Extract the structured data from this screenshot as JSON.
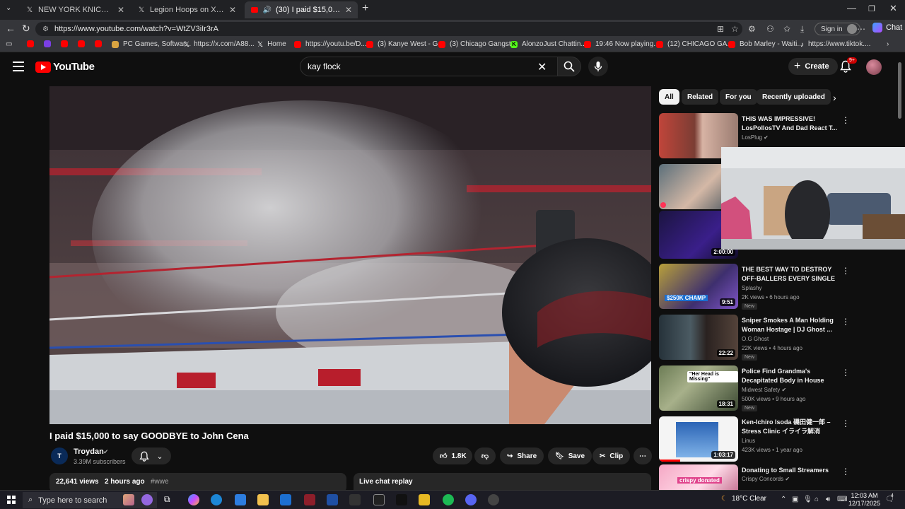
{
  "browser": {
    "tabs": [
      {
        "title": "NEW YORK KNICKS on X: \"THE CU",
        "icon": "x-logo-icon",
        "active": false
      },
      {
        "title": "Legion Hoops on X: \"The league a",
        "icon": "x-logo-icon",
        "active": false
      },
      {
        "title": "(30) I paid $15,000 to say GOO",
        "icon": "youtube-icon",
        "active": true
      }
    ],
    "url": "https://www.youtube.com/watch?v=WtZV3iIr3rA",
    "signin_label": "Sign in",
    "chat_label": "Chat",
    "bookmarks": [
      {
        "label": "",
        "icon": "youtube-icon"
      },
      {
        "label": "",
        "icon": "purple-app-icon"
      },
      {
        "label": "",
        "icon": "youtube-icon"
      },
      {
        "label": "",
        "icon": "youtube-icon"
      },
      {
        "label": "",
        "icon": "youtube-icon"
      },
      {
        "label": "PC Games, Softwar...",
        "icon": "site-icon"
      },
      {
        "label": "https://x.com/A88...",
        "icon": "x-logo-icon"
      },
      {
        "label": "Home",
        "icon": "x-logo-icon"
      },
      {
        "label": "https://youtu.be/D...",
        "icon": "youtube-icon"
      },
      {
        "label": "(3) Kanye West - G...",
        "icon": "youtube-icon"
      },
      {
        "label": "(3) Chicago Gangst...",
        "icon": "youtube-icon"
      },
      {
        "label": "AlonzoJust Chattin...",
        "icon": "kick-icon"
      },
      {
        "label": "19:46 Now playing...",
        "icon": "youtube-icon"
      },
      {
        "label": "(12) CHICAGO GA...",
        "icon": "youtube-icon"
      },
      {
        "label": "Bob Marley - Waiti...",
        "icon": "youtube-icon"
      },
      {
        "label": "https://www.tiktok....",
        "icon": "tiktok-icon"
      }
    ]
  },
  "youtube": {
    "logo_text": "YouTube",
    "search_value": "kay flock",
    "create_label": "Create",
    "notif_badge": "9+",
    "video": {
      "title": "I paid $15,000 to say GOODBYE to John Cena",
      "channel": "Troydan",
      "subscribers": "3.39M subscribers",
      "likes": "1.8K",
      "share_label": "Share",
      "save_label": "Save",
      "clip_label": "Clip",
      "views": "22,641 views",
      "age": "2 hours ago",
      "hashtag": "#wwe",
      "live_chat_label": "Live chat replay"
    },
    "chips": [
      "All",
      "Related",
      "For you",
      "Recently uploaded"
    ],
    "recommendations": [
      {
        "title": "THIS WAS IMPRESSIVE! LosPollosTV And Dad React T...",
        "channel": "LosPlug",
        "verified": true,
        "meta": "",
        "duration": "",
        "new": false
      },
      {
        "title": "",
        "channel": "",
        "verified": false,
        "meta": "",
        "duration": "2:00:00",
        "new": false
      },
      {
        "title": "THE BEST WAY TO DESTROY OFF-BALLERS EVERY SINGLE ...",
        "channel": "Splashy",
        "verified": false,
        "meta": "2K views • 6 hours ago",
        "duration": "9:51",
        "new": true
      },
      {
        "title": "Sniper Smokes A Man Holding Woman Hostage | DJ Ghost ...",
        "channel": "O.G Ghost",
        "verified": false,
        "meta": "22K views • 4 hours ago",
        "duration": "22:22",
        "new": true
      },
      {
        "title": "Police Find Grandma's Decapitated Body in House",
        "channel": "Midwest Safety",
        "verified": true,
        "meta": "500K views • 9 hours ago",
        "duration": "18:31",
        "new": true
      },
      {
        "title": "Ken-Ichiro Isoda 磯田健一郎 – Stress Clinic イライラ解消",
        "channel": "Linus",
        "verified": false,
        "meta": "423K views • 1 year ago",
        "duration": "1:03:17",
        "new": false
      },
      {
        "title": "Donating to Small Streamers",
        "channel": "Crispy Concords",
        "verified": true,
        "meta": "",
        "duration": "",
        "new": false
      }
    ],
    "thumb_texts": {
      "rec3_badge": "$250K CHAMP",
      "rec5_caption": "\"Her Head is Missing\"",
      "rec7_caption": "crispy donated"
    }
  },
  "taskbar": {
    "search_placeholder": "Type here to search",
    "weather": "18°C  Clear",
    "time": "12:03 AM",
    "date": "12/17/2025",
    "notif_count": "4"
  },
  "colors": {
    "yt_red": "#ff0000",
    "background": "#0f0f0f",
    "chip_bg": "#272727"
  }
}
